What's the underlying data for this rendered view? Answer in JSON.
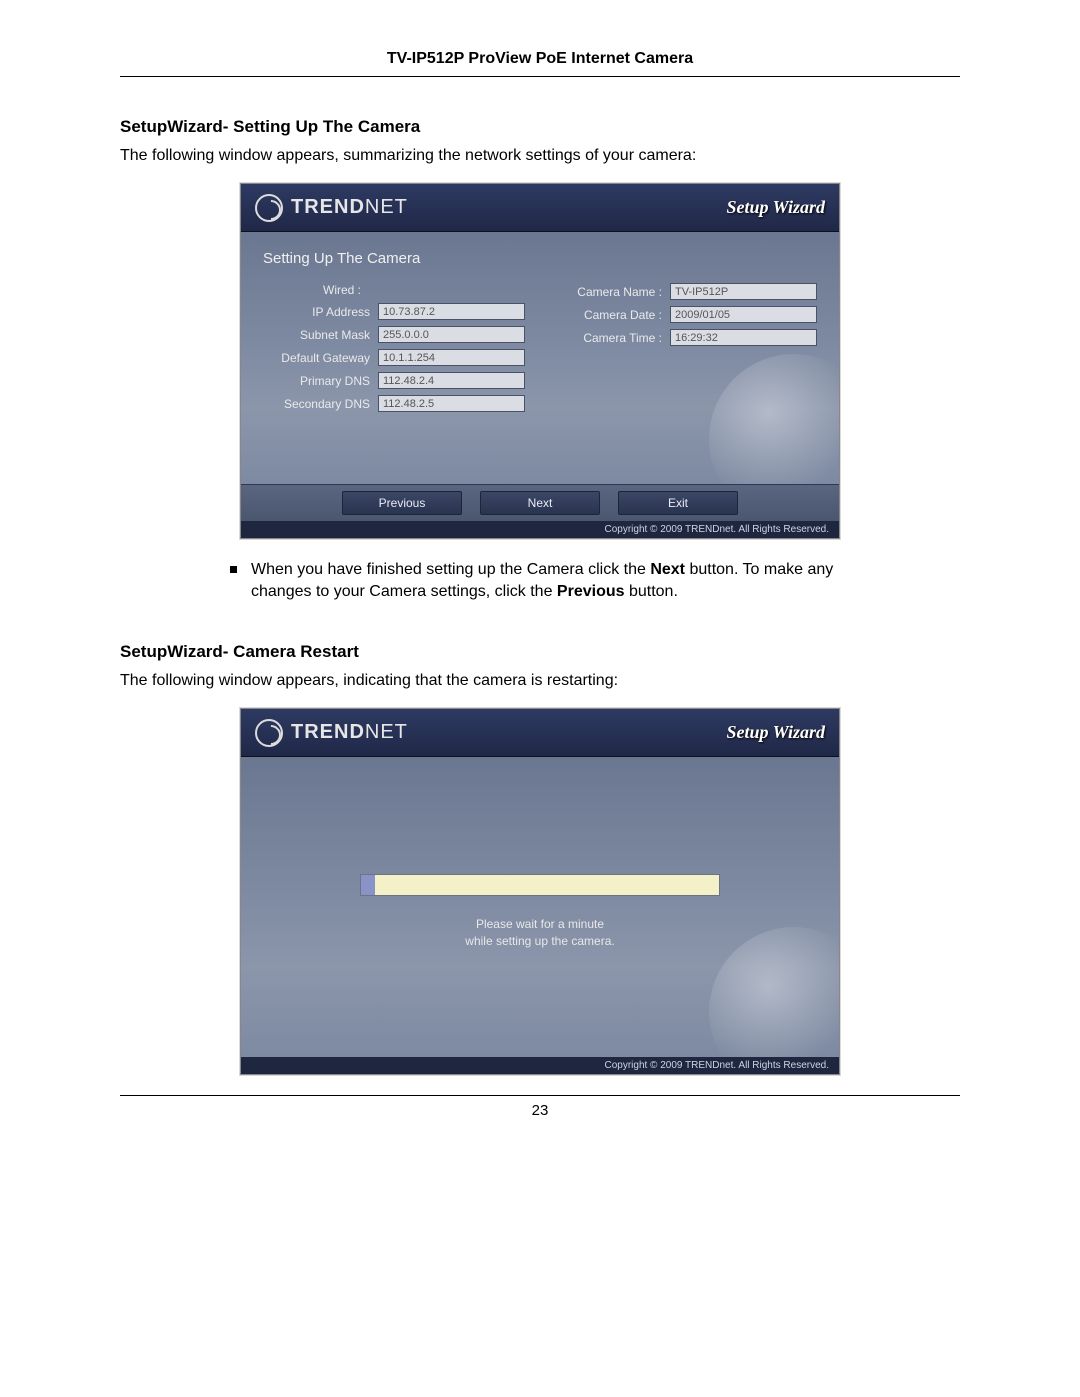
{
  "doc": {
    "header": "TV-IP512P ProView PoE Internet Camera",
    "page_number": "23"
  },
  "section1": {
    "title": "SetupWizard- Setting Up The Camera",
    "intro": "The following window appears, summarizing the network settings of your camera:",
    "bullet_pre": "When you have finished setting up the Camera click the ",
    "bullet_bold1": "Next",
    "bullet_mid": " button. To make any changes to your Camera settings, click the ",
    "bullet_bold2": "Previous",
    "bullet_post": " button."
  },
  "section2": {
    "title": "SetupWizard- Camera Restart",
    "intro": "The following window appears, indicating that the camera is restarting:"
  },
  "wizard": {
    "brand_a": "TREND",
    "brand_b": "NET",
    "title": "Setup Wizard",
    "panel_title": "Setting Up The Camera",
    "copyright": "Copyright © 2009 TRENDnet. All Rights Reserved.",
    "buttons": {
      "previous": "Previous",
      "next": "Next",
      "exit": "Exit"
    },
    "left_header": "Wired :",
    "left": {
      "ip_label": "IP Address",
      "ip_value": "10.73.87.2",
      "subnet_label": "Subnet Mask",
      "subnet_value": "255.0.0.0",
      "gateway_label": "Default Gateway",
      "gateway_value": "10.1.1.254",
      "pdns_label": "Primary DNS",
      "pdns_value": "112.48.2.4",
      "sdns_label": "Secondary DNS",
      "sdns_value": "112.48.2.5"
    },
    "right": {
      "name_label": "Camera Name :",
      "name_value": "TV-IP512P",
      "date_label": "Camera Date :",
      "date_value": "2009/01/05",
      "time_label": "Camera Time :",
      "time_value": "16:29:32"
    }
  },
  "wizard2": {
    "wait_line1": "Please wait for a minute",
    "wait_line2": "while setting up the camera."
  }
}
